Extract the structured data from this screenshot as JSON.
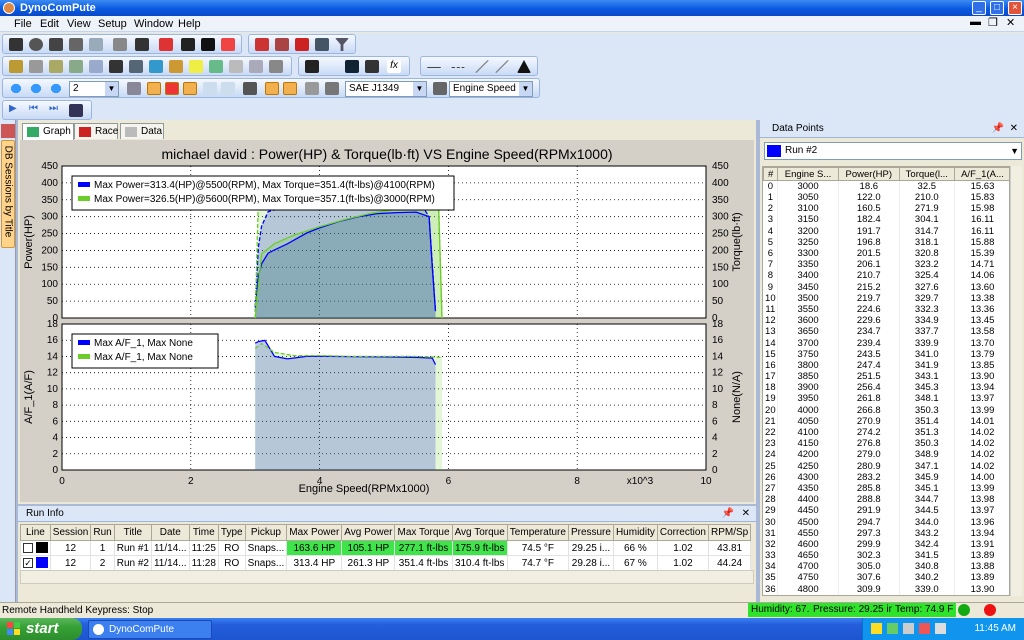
{
  "app": {
    "title": "DynoComPute"
  },
  "menu": [
    "File",
    "Edit",
    "View",
    "Setup",
    "Window",
    "Help"
  ],
  "toolbar": {
    "zoom_value": "2",
    "correction_standard": "SAE J1349",
    "x_axis_mode": "Engine Speed"
  },
  "tabs": [
    {
      "label": "Graph"
    },
    {
      "label": "Race"
    },
    {
      "label": "Data"
    }
  ],
  "side_tab": "DB Sessions by Title",
  "chart": {
    "title": "michael david : Power(HP) & Torque(lb·ft) VS Engine Speed(RPMx1000)",
    "xlabel": "Engine Speed(RPMx1000)",
    "x_exp": "x10^3",
    "top_ylabel_left": "Power(HP)",
    "top_ylabel_right": "Torque(lb·ft)",
    "bottom_ylabel_left": "A/F_1(A/F)",
    "bottom_ylabel_right": "None(N/A)",
    "legend_top": [
      {
        "text": "Max Power=313.4(HP)@5500(RPM), Max Torque=351.4(ft-lbs)@4100(RPM)",
        "color": "#0000ff"
      },
      {
        "text": "Max Power=326.5(HP)@5600(RPM), Max Torque=357.1(ft-lbs)@3000(RPM)",
        "color": "#6ccd28"
      }
    ],
    "legend_bottom": [
      {
        "text": "Max A/F_1, Max None",
        "color": "#0000ff"
      },
      {
        "text": "Max A/F_1, Max None",
        "color": "#6ccd28"
      }
    ],
    "x_ticks": [
      "0",
      "2",
      "4",
      "6",
      "8",
      "10"
    ],
    "top_y_ticks": [
      "0",
      "50",
      "100",
      "150",
      "200",
      "250",
      "300",
      "350",
      "400",
      "450"
    ],
    "top_y_ticks_right": [
      "0",
      "50",
      "100",
      "150",
      "200",
      "250",
      "300",
      "350",
      "400",
      "450"
    ],
    "bottom_y_ticks": [
      "0",
      "2",
      "4",
      "6",
      "8",
      "10",
      "12",
      "14",
      "16",
      "18"
    ],
    "bottom_y_ticks_right": [
      "0",
      "2",
      "4",
      "6",
      "8",
      "10",
      "12",
      "14",
      "16",
      "18"
    ]
  },
  "chart_data": [
    {
      "type": "line",
      "title": "michael david : Power(HP) & Torque(lb·ft) VS Engine Speed(RPMx1000)",
      "ylabel": "Power(HP)",
      "xlim": [
        0,
        10
      ],
      "ylim": [
        0,
        450
      ],
      "grid": true,
      "legend": "top-left",
      "series": [
        {
          "name": "Max Power=313.4(HP)@5500(RPM), Max Torque=351.4(ft-lbs)@4100(RPM)",
          "color": "#0000ff",
          "x": [
            3.0,
            3.05,
            3.1,
            3.2,
            3.3,
            3.5,
            3.8,
            4.0,
            4.3,
            4.6,
            4.9,
            5.2,
            5.5,
            5.7,
            5.75,
            5.8
          ],
          "y": [
            18.6,
            122,
            160.5,
            191.7,
            201.5,
            219.7,
            251.5,
            266.8,
            285.8,
            299.9,
            309,
            312,
            313.4,
            300,
            150,
            20
          ]
        },
        {
          "name": "Max Power=313.4(HP)@5500(RPM), Max Torque=351.4(ft-lbs)@4100(RPM)",
          "color": "#0000ff",
          "x": [
            3.0,
            3.05,
            3.1,
            3.2,
            3.4,
            3.6,
            3.8,
            4.1,
            4.4,
            4.7,
            5.0,
            5.3,
            5.6,
            5.7,
            5.75,
            5.8
          ],
          "y": [
            32.5,
            210,
            271.9,
            314.7,
            325.4,
            334.9,
            343.1,
            351.4,
            345.3,
            342.0,
            338,
            335,
            330,
            300,
            160,
            20
          ]
        },
        {
          "name": "Max Power=326.5(HP)@5600(RPM), Max Torque=357.1(ft-lbs)@3000(RPM)",
          "color": "#6ccd28",
          "x": [
            3.0,
            3.1,
            3.3,
            3.6,
            4.0,
            4.4,
            4.8,
            5.2,
            5.6,
            5.85,
            5.9
          ],
          "y": [
            0,
            190,
            220,
            245,
            270,
            292,
            310,
            322,
            326.5,
            320,
            0
          ]
        },
        {
          "name": "Max Power=326.5(HP)@5600(RPM), Max Torque=357.1(ft-lbs)@3000(RPM)",
          "color": "#6ccd28",
          "x": [
            3.0,
            3.05,
            3.2,
            3.5,
            4.0,
            4.5,
            5.0,
            5.5,
            5.85,
            5.9
          ],
          "y": [
            0,
            357.1,
            352,
            348,
            347,
            345,
            343,
            340,
            335,
            0
          ]
        }
      ]
    },
    {
      "type": "line",
      "ylabel": "A/F_1(A/F)",
      "xlim": [
        0,
        10
      ],
      "ylim": [
        0,
        18
      ],
      "grid": true,
      "legend": "top-left",
      "series": [
        {
          "name": "Max A/F_1, Max None",
          "color": "#0000ff",
          "x": [
            3.0,
            3.05,
            3.15,
            3.3,
            3.5,
            3.8,
            4.1,
            4.5,
            5.0,
            5.5,
            5.75,
            5.8
          ],
          "y": [
            15.63,
            15.83,
            15.98,
            14.0,
            13.7,
            14.0,
            14.0,
            13.98,
            13.95,
            13.9,
            13.8,
            13.0
          ]
        },
        {
          "name": "Max A/F_1, Max None",
          "color": "#6ccd28",
          "x": [
            3.0,
            3.1,
            3.3,
            3.6,
            4.0,
            4.5,
            5.0,
            5.5,
            5.9
          ],
          "y": [
            15.0,
            15.6,
            14.5,
            14.1,
            14.1,
            14.0,
            14.0,
            14.0,
            13.9
          ]
        }
      ]
    }
  ],
  "run_info": {
    "title": "Run Info",
    "columns": [
      "Line",
      "Session",
      "Run",
      "Title",
      "Date",
      "Time",
      "Type",
      "Pickup",
      "Max Power",
      "Avg Power",
      "Max Torque",
      "Avg Torque",
      "Temperature",
      "Pressure",
      "Humidity",
      "Correction",
      "RPM/Sp"
    ],
    "rows": [
      {
        "checked": "",
        "color": "#000000",
        "session": "12",
        "run": "1",
        "title": "Run #1",
        "date": "11/14...",
        "time": "11:25",
        "type": "RO",
        "pickup": "Snaps...",
        "max_power": "163.6 HP",
        "avg_power": "105.1 HP",
        "max_torque": "277.1 ft-lbs",
        "avg_torque": "175.9 ft-lbs",
        "temperature": "74.5 °F",
        "pressure": "29.25 i...",
        "humidity": "66 %",
        "correction": "1.02",
        "rpm": "43.81"
      },
      {
        "checked": "✓",
        "color": "#0000ff",
        "session": "12",
        "run": "2",
        "title": "Run #2",
        "date": "11/14...",
        "time": "11:28",
        "type": "RO",
        "pickup": "Snaps...",
        "max_power": "313.4 HP",
        "avg_power": "261.3 HP",
        "max_torque": "351.4 ft-lbs",
        "avg_torque": "310.4 ft-lbs",
        "temperature": "74.7 °F",
        "pressure": "29.28 i...",
        "humidity": "67 %",
        "correction": "1.02",
        "rpm": "44.24"
      }
    ]
  },
  "data_points": {
    "title": "Data Points",
    "run": "Run #2",
    "columns": [
      "#",
      "Engine S...",
      "Power(HP)",
      "Torque(l...",
      "A/F_1(A..."
    ],
    "rows": [
      [
        "0",
        "3000",
        "18.6",
        "32.5",
        "15.63"
      ],
      [
        "1",
        "3050",
        "122.0",
        "210.0",
        "15.83"
      ],
      [
        "2",
        "3100",
        "160.5",
        "271.9",
        "15.98"
      ],
      [
        "3",
        "3150",
        "182.4",
        "304.1",
        "16.11"
      ],
      [
        "4",
        "3200",
        "191.7",
        "314.7",
        "16.11"
      ],
      [
        "5",
        "3250",
        "196.8",
        "318.1",
        "15.88"
      ],
      [
        "6",
        "3300",
        "201.5",
        "320.8",
        "15.39"
      ],
      [
        "7",
        "3350",
        "206.1",
        "323.2",
        "14.71"
      ],
      [
        "8",
        "3400",
        "210.7",
        "325.4",
        "14.06"
      ],
      [
        "9",
        "3450",
        "215.2",
        "327.6",
        "13.60"
      ],
      [
        "10",
        "3500",
        "219.7",
        "329.7",
        "13.38"
      ],
      [
        "11",
        "3550",
        "224.6",
        "332.3",
        "13.36"
      ],
      [
        "12",
        "3600",
        "229.6",
        "334.9",
        "13.45"
      ],
      [
        "13",
        "3650",
        "234.7",
        "337.7",
        "13.58"
      ],
      [
        "14",
        "3700",
        "239.4",
        "339.9",
        "13.70"
      ],
      [
        "15",
        "3750",
        "243.5",
        "341.0",
        "13.79"
      ],
      [
        "16",
        "3800",
        "247.4",
        "341.9",
        "13.85"
      ],
      [
        "17",
        "3850",
        "251.5",
        "343.1",
        "13.90"
      ],
      [
        "18",
        "3900",
        "256.4",
        "345.3",
        "13.94"
      ],
      [
        "19",
        "3950",
        "261.8",
        "348.1",
        "13.97"
      ],
      [
        "20",
        "4000",
        "266.8",
        "350.3",
        "13.99"
      ],
      [
        "21",
        "4050",
        "270.9",
        "351.4",
        "14.01"
      ],
      [
        "22",
        "4100",
        "274.2",
        "351.3",
        "14.02"
      ],
      [
        "23",
        "4150",
        "276.8",
        "350.3",
        "14.02"
      ],
      [
        "24",
        "4200",
        "279.0",
        "348.9",
        "14.02"
      ],
      [
        "25",
        "4250",
        "280.9",
        "347.1",
        "14.02"
      ],
      [
        "26",
        "4300",
        "283.2",
        "345.9",
        "14.00"
      ],
      [
        "27",
        "4350",
        "285.8",
        "345.1",
        "13.99"
      ],
      [
        "28",
        "4400",
        "288.8",
        "344.7",
        "13.98"
      ],
      [
        "29",
        "4450",
        "291.9",
        "344.5",
        "13.97"
      ],
      [
        "30",
        "4500",
        "294.7",
        "344.0",
        "13.96"
      ],
      [
        "31",
        "4550",
        "297.3",
        "343.2",
        "13.94"
      ],
      [
        "32",
        "4600",
        "299.9",
        "342.4",
        "13.91"
      ],
      [
        "33",
        "4650",
        "302.3",
        "341.5",
        "13.89"
      ],
      [
        "34",
        "4700",
        "305.0",
        "340.8",
        "13.88"
      ],
      [
        "35",
        "4750",
        "307.6",
        "340.2",
        "13.89"
      ],
      [
        "36",
        "4800",
        "309.9",
        "339.0",
        "13.90"
      ]
    ]
  },
  "status": {
    "message": "Remote Handheld Keypress: Stop",
    "humidity": "Humidity: 67.5%",
    "pressure": "Pressure: 29.25 inHg",
    "temp": "Temp: 74.9 F"
  },
  "taskbar": {
    "start": "start",
    "task": "DynoComPute",
    "clock": "11:45 AM"
  }
}
